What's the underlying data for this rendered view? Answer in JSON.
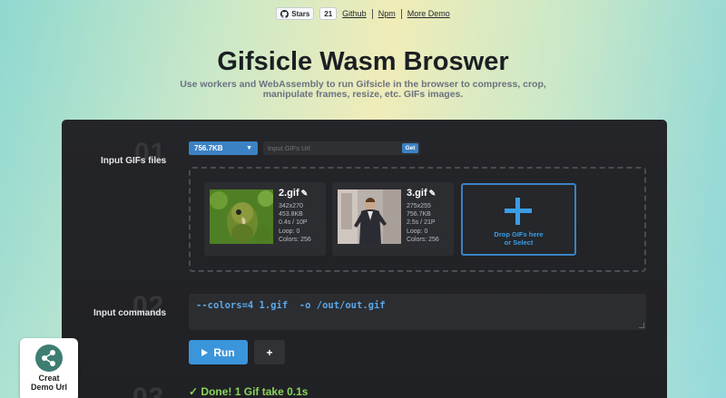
{
  "topbar": {
    "stars_label": "Stars",
    "stars_count": "21",
    "links": [
      "Github",
      "Npm",
      "More Demo"
    ]
  },
  "header": {
    "title": "Gifsicle Wasm Broswer",
    "subtitle": "Use workers and WebAssembly to run Gifsicle in the browser to compress, crop, manipulate frames, resize, etc. GIFs images."
  },
  "steps": [
    {
      "num": "01",
      "label": "Input GIFs files"
    },
    {
      "num": "02",
      "label": "Input commands"
    },
    {
      "num": "03",
      "label": ""
    }
  ],
  "input": {
    "size_selected": "756.7KB",
    "url_placeholder": "Input GIFs Url",
    "get_label": "Get"
  },
  "gifs": [
    {
      "name": "2.gif",
      "dims": "342x270",
      "size": "453.8KB",
      "duration": "0.4s / 10P",
      "loop": "Loop: 0",
      "colors": "Colors: 256"
    },
    {
      "name": "3.gif",
      "dims": "275x255",
      "size": "756.7KB",
      "duration": "2.5s / 21P",
      "loop": "Loop: 0",
      "colors": "Colors: 256"
    }
  ],
  "dropzone": {
    "line1": "Drop GIFs here",
    "line2": "or Select"
  },
  "command": "--colors=4 1.gif  -o /out/out.gif",
  "actions": {
    "run_label": "Run",
    "add_label": "+"
  },
  "result": "Done! 1 Gif take 0.1s",
  "share": {
    "line1": "Creat",
    "line2": "Demo Url"
  },
  "colors": {
    "accent": "#3b95db",
    "panel": "#232427",
    "success": "#8bd45a"
  }
}
